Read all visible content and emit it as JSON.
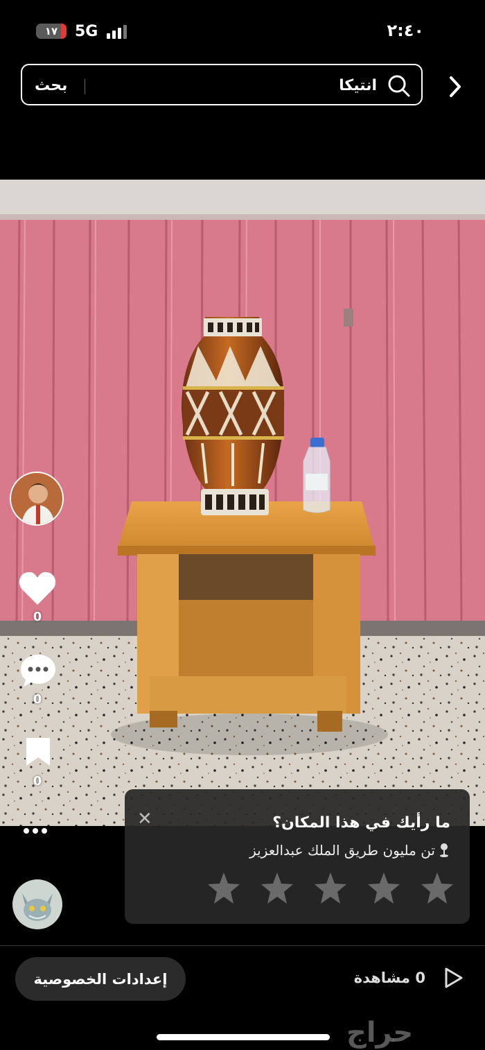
{
  "status_bar": {
    "time": "٢:٤٠",
    "battery": "١٧",
    "network": "5G"
  },
  "search": {
    "query": "انتيكا",
    "button_label": "بحث"
  },
  "post": {
    "likes": "0",
    "comments": "0",
    "saves": "0",
    "views_count": "0",
    "views_label": "مشاهدة"
  },
  "rating_card": {
    "question": "ما رأيك في هذا المكان؟",
    "location": "تن مليون طريق الملك عبدالعزيز",
    "stars": 5
  },
  "privacy_button": "إعدادات الخصوصية",
  "watermark": "حراج",
  "colors": {
    "background": "#000000",
    "card": "#282828",
    "battery_low": "#e53935",
    "wall_pink": "#d9798c",
    "table_wood": "#d99636"
  }
}
